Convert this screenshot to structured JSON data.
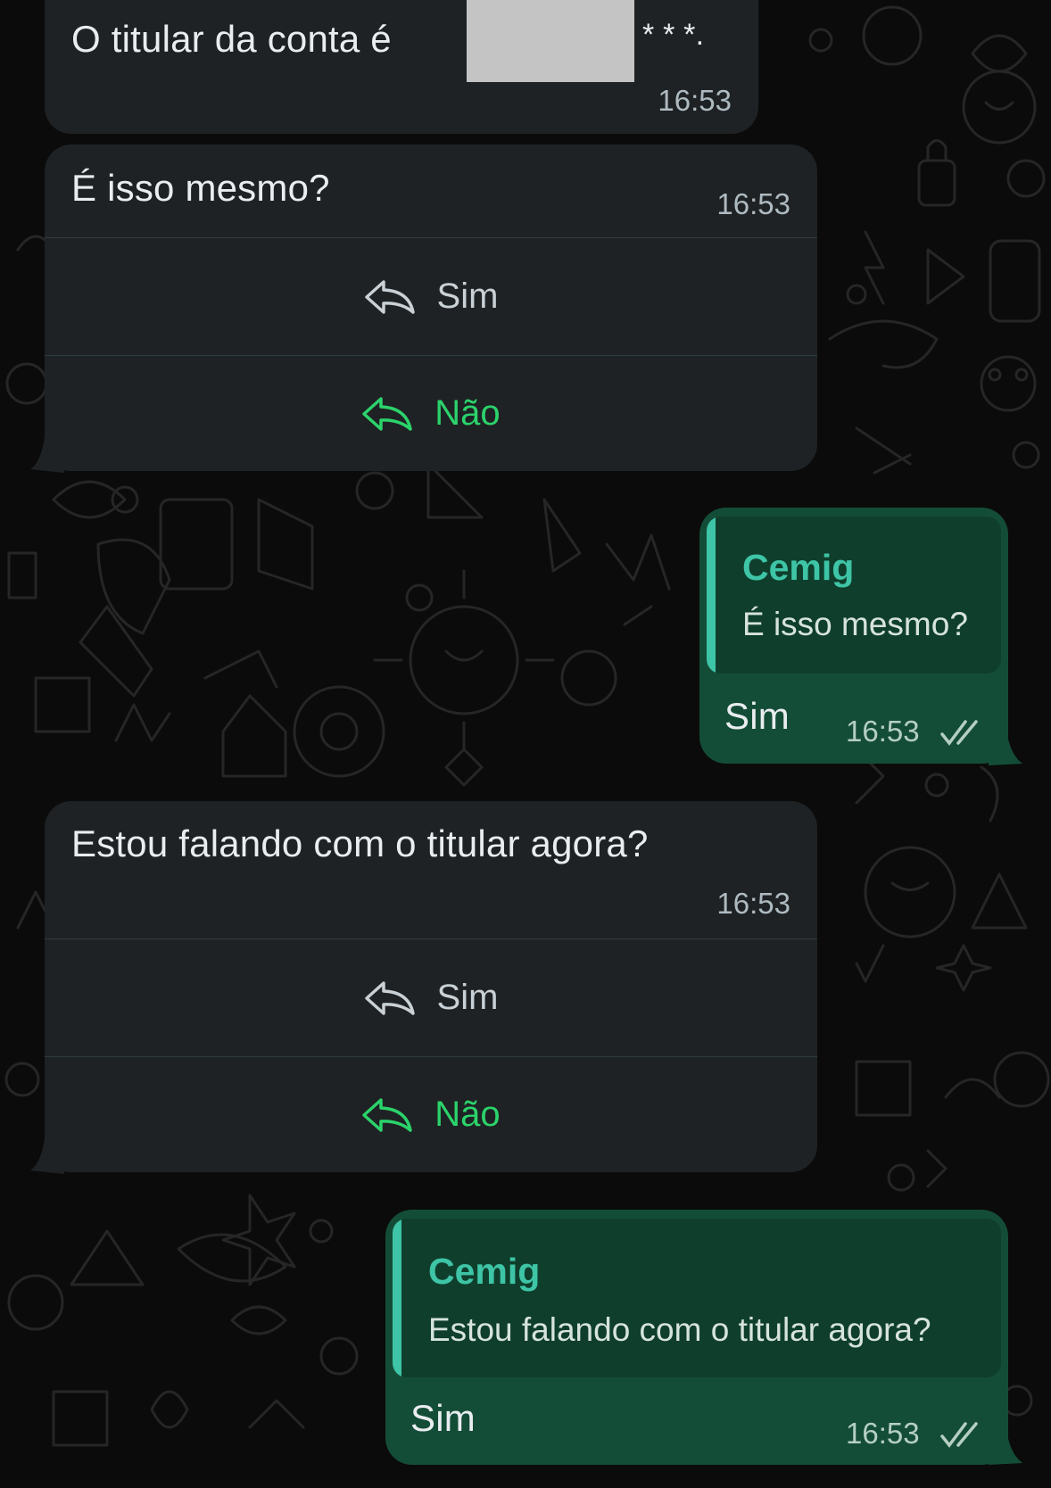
{
  "chat": {
    "messages": [
      {
        "text_before": "O titular da conta é",
        "text_after": "* * *.",
        "time": "16:53"
      },
      {
        "text": "É isso mesmo?",
        "time": "16:53",
        "buttons": [
          {
            "label": "Sim"
          },
          {
            "label": "Não"
          }
        ]
      },
      {
        "quote_author": "Cemig",
        "quote_text": "É isso mesmo?",
        "text": "Sim",
        "time": "16:53"
      },
      {
        "text": "Estou falando com o titular agora?",
        "time": "16:53",
        "buttons": [
          {
            "label": "Sim"
          },
          {
            "label": "Não"
          }
        ]
      },
      {
        "quote_author": "Cemig",
        "quote_text": "Estou falando com o titular agora?",
        "text": "Sim",
        "time": "16:53"
      }
    ]
  },
  "colors": {
    "background": "#0b0b0b",
    "incoming_bubble": "#1f2224",
    "outgoing_bubble": "#144d37",
    "quote_accent": "#3ec4a6",
    "nao_button": "#2bd36b",
    "read_ticks": "#b5cfc3"
  },
  "icons": {
    "reply": "reply-arrow-icon",
    "read_receipt": "double-check-icon"
  }
}
